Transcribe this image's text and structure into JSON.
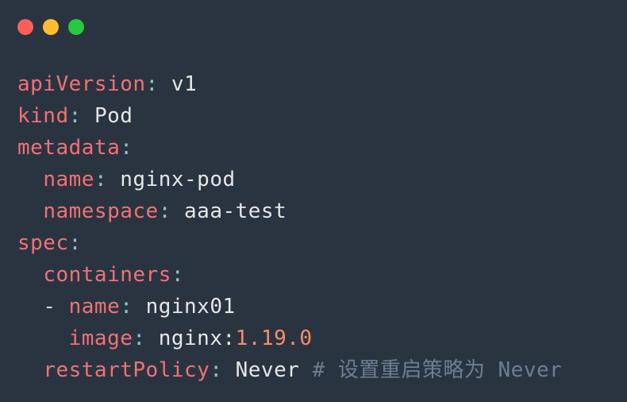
{
  "window": {
    "dots": {
      "red": "#ff5f56",
      "yellow": "#ffbd2e",
      "green": "#27c93f"
    }
  },
  "yaml": {
    "lines": [
      {
        "indent": 0,
        "key": "apiVersion",
        "value": "v1",
        "vtype": "s"
      },
      {
        "indent": 0,
        "key": "kind",
        "value": "Pod",
        "vtype": "s"
      },
      {
        "indent": 0,
        "key": "metadata",
        "value": "",
        "vtype": "none"
      },
      {
        "indent": 1,
        "key": "name",
        "value": "nginx-pod",
        "vtype": "s"
      },
      {
        "indent": 1,
        "key": "namespace",
        "value": "aaa-test",
        "vtype": "s"
      },
      {
        "indent": 0,
        "key": "spec",
        "value": "",
        "vtype": "none"
      },
      {
        "indent": 1,
        "key": "containers",
        "value": "",
        "vtype": "none"
      },
      {
        "indent": 1,
        "dash": true,
        "key": "name",
        "value": "nginx01",
        "vtype": "s"
      },
      {
        "indent": 2,
        "key": "image",
        "value_name": "nginx:",
        "value_ver": "1.19.0",
        "vtype": "img"
      },
      {
        "indent": 1,
        "key": "restartPolicy",
        "value": "Never",
        "vtype": "s",
        "comment": "# 设置重启策略为 Never"
      }
    ]
  }
}
